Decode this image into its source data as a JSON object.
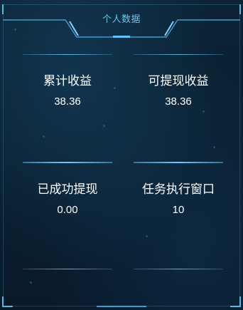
{
  "panel": {
    "title": "个人数据"
  },
  "stats": [
    {
      "label": "累计收益",
      "value": "38.36"
    },
    {
      "label": "可提现收益",
      "value": "38.36"
    },
    {
      "label": "已成功提现",
      "value": "0.00"
    },
    {
      "label": "任务执行窗口",
      "value": "10"
    }
  ],
  "colors": {
    "background": "#0a1c2b",
    "accent": "#5ab6e4",
    "title": "#68c7ea",
    "text": "#ffffff"
  }
}
